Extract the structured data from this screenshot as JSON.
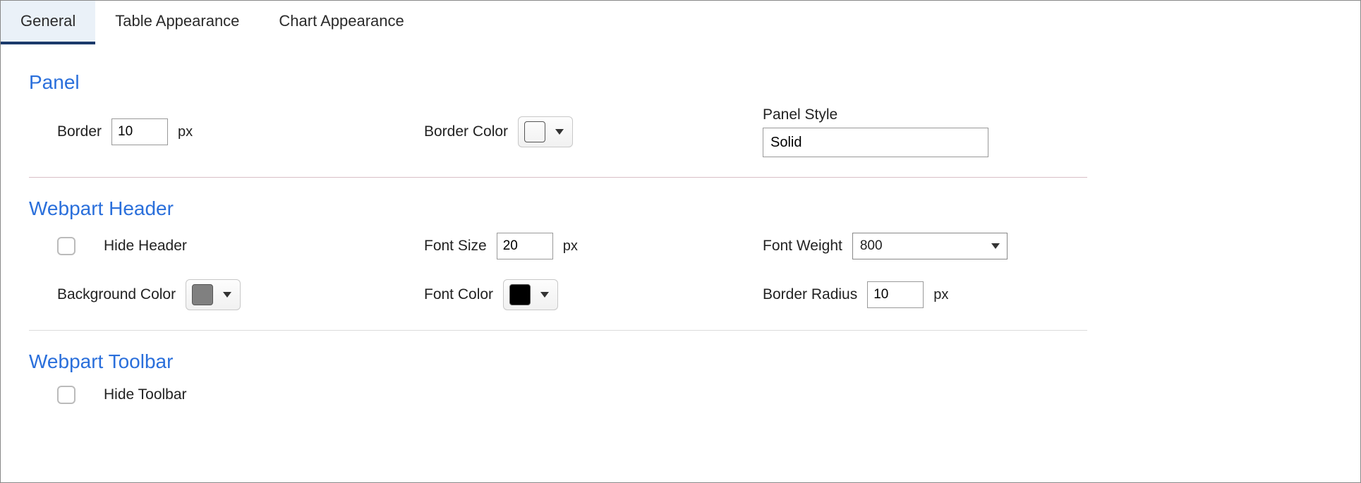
{
  "tabs": {
    "general": "General",
    "table_appearance": "Table Appearance",
    "chart_appearance": "Chart Appearance"
  },
  "panel": {
    "title": "Panel",
    "border_label": "Border",
    "border_value": "10",
    "border_unit": "px",
    "border_color_label": "Border Color",
    "border_color_value": "#000000",
    "panel_style_label": "Panel Style",
    "panel_style_value": "Solid"
  },
  "header": {
    "title": "Webpart Header",
    "hide_header_label": "Hide Header",
    "font_size_label": "Font Size",
    "font_size_value": "20",
    "font_size_unit": "px",
    "font_weight_label": "Font Weight",
    "font_weight_value": "800",
    "bg_color_label": "Background Color",
    "bg_color_value": "#808080",
    "font_color_label": "Font Color",
    "font_color_value": "#000000",
    "border_radius_label": "Border Radius",
    "border_radius_value": "10",
    "border_radius_unit": "px"
  },
  "toolbar": {
    "title": "Webpart Toolbar",
    "hide_toolbar_label": "Hide Toolbar"
  }
}
